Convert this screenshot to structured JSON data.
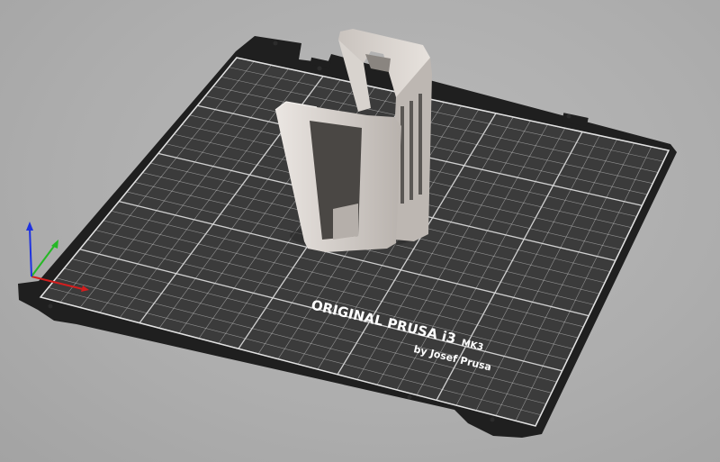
{
  "viewport": {
    "name": "3D plater view",
    "background_color": "#aeaeae"
  },
  "bed": {
    "label_main": "ORIGINAL PRUSA i3",
    "label_model": "MK3",
    "label_sub": "by Josef Prusa",
    "surface_color": "#3b3b3b",
    "grid_color": "#d9d9d9",
    "frame_color": "#1f1f1f"
  },
  "model": {
    "name": "cage-shaped-holder",
    "color": "#cdc7c2"
  },
  "axes": {
    "x_color": "#d31e1e",
    "y_color": "#25b825",
    "z_color": "#1e32e0"
  }
}
